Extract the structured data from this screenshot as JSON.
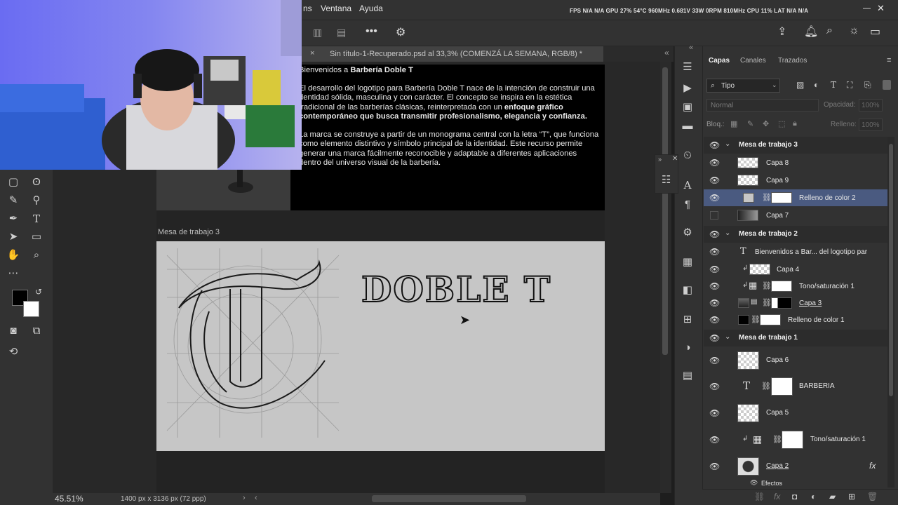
{
  "menu": {
    "items": [
      "ns",
      "Ventana",
      "Ayuda"
    ],
    "perf_text": "FPS N/A N/A   GPU 27% 54°C 960MHz 0.681V 33W 0RPM 810MHz   CPU 11%   LAT N/A N/A"
  },
  "document": {
    "tab_title": "Sin título-1-Recuperado.psd al 33,3% (COMENZÁ LA SEMANA, RGB/8) *",
    "close_glyph": "×"
  },
  "artboard2": {
    "intro_plain": "Bienvenidos a ",
    "intro_bold": "Barbería Doble T",
    "para1_plain": "El desarrollo del logotipo para Barbería Doble T nace de la intención de construir una dentidad sólida, masculina y con carácter. El concepto se inspira en la estética tradicional de las barberías clásicas, reinterpretada con un ",
    "para1_bold": "enfoque gráfico contemporáneo que busca transmitir profesionalismo, elegancia y confianza.",
    "para2": "La marca se construye a partir de un monograma central con la letra “T”, que funciona como elemento distintivo y símbolo principal de la identidad. Este recurso permite generar una marca fácilmente reconocible y adaptable a diferentes aplicaciones dentro del universo visual de la barbería."
  },
  "artboard3": {
    "label": "Mesa de trabajo 3",
    "wordmark": "DOBLE T"
  },
  "status": {
    "zoom": "45.51%",
    "dimensions": "1400 px x 3136 px (72 ppp)"
  },
  "panel": {
    "tabs": [
      "Capas",
      "Canales",
      "Trazados"
    ],
    "filter": "Tipo",
    "blend_mode": "Normal",
    "opacity_label": "Opacidad:",
    "opacity_value": "100%",
    "lock_label": "Bloq.:",
    "fill_label": "Relleno:",
    "fill_value": "100%"
  },
  "layers": [
    {
      "name": "Mesa de trabajo 3",
      "type": "group"
    },
    {
      "name": "Capa 8",
      "type": "layer"
    },
    {
      "name": "Capa 9",
      "type": "layer"
    },
    {
      "name": "Relleno de color 2",
      "type": "fill",
      "selected": true
    },
    {
      "name": "Capa 7",
      "type": "layer",
      "hidden": true
    },
    {
      "name": "Mesa de trabajo 2",
      "type": "group"
    },
    {
      "name": "Bienvenidos a Bar... del logotipo par",
      "type": "text"
    },
    {
      "name": "Capa 4",
      "type": "layer"
    },
    {
      "name": "Tono/saturación 1",
      "type": "adjustment"
    },
    {
      "name": "Capa 3",
      "type": "layer"
    },
    {
      "name": "Relleno de color 1",
      "type": "fill"
    },
    {
      "name": "Mesa de trabajo 1",
      "type": "group"
    },
    {
      "name": "Capa 6",
      "type": "layer"
    },
    {
      "name": "BARBERIA",
      "type": "text"
    },
    {
      "name": "Capa 5",
      "type": "layer"
    },
    {
      "name": "Tono/saturación 1",
      "type": "adjustment"
    },
    {
      "name": "Capa 2",
      "type": "layer"
    },
    {
      "name": "Efectos",
      "type": "effects"
    }
  ],
  "colors": {
    "accent_selected": "#4a5a80",
    "panel_bg": "#323232",
    "artboard_bg": "#c6c6c6"
  }
}
